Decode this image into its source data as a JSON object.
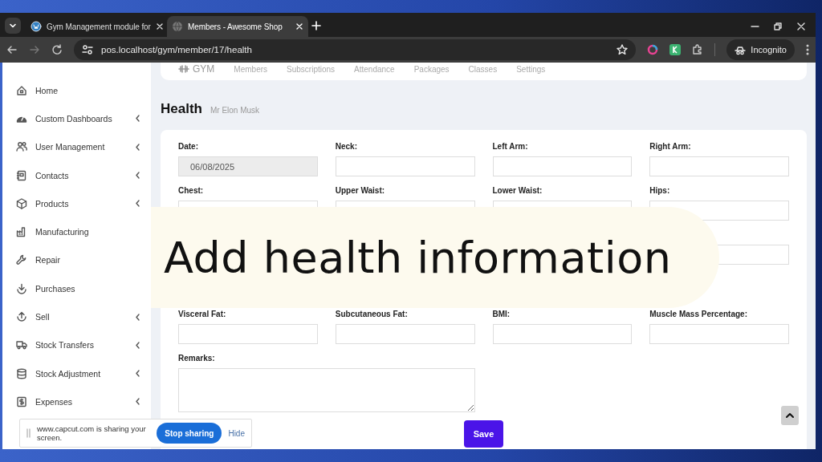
{
  "browser": {
    "tabs": [
      {
        "title": "Gym Management module for",
        "selected": false
      },
      {
        "title": "Members - Awesome Shop",
        "selected": true
      }
    ],
    "address": "pos.localhost/gym/member/17/health",
    "profile": "Incognito"
  },
  "sidebar": {
    "items": [
      {
        "label": "Home",
        "has_submenu": false
      },
      {
        "label": "Custom Dashboards",
        "has_submenu": true
      },
      {
        "label": "User Management",
        "has_submenu": true
      },
      {
        "label": "Contacts",
        "has_submenu": true
      },
      {
        "label": "Products",
        "has_submenu": true
      },
      {
        "label": "Manufacturing",
        "has_submenu": false
      },
      {
        "label": "Repair",
        "has_submenu": false
      },
      {
        "label": "Purchases",
        "has_submenu": false
      },
      {
        "label": "Sell",
        "has_submenu": true
      },
      {
        "label": "Stock Transfers",
        "has_submenu": true
      },
      {
        "label": "Stock Adjustment",
        "has_submenu": true
      },
      {
        "label": "Expenses",
        "has_submenu": true
      }
    ]
  },
  "top_nav": {
    "brand": "GYM",
    "items": [
      "Members",
      "Subscriptions",
      "Attendance",
      "Packages",
      "Classes",
      "Settings"
    ]
  },
  "page": {
    "title": "Health",
    "subtitle": "Mr Elon Musk"
  },
  "form": {
    "fields": [
      {
        "label": "Date:",
        "kind": "input",
        "value": "06/08/2025",
        "disabled": true
      },
      {
        "label": "Neck:",
        "kind": "input"
      },
      {
        "label": "Left Arm:",
        "kind": "input"
      },
      {
        "label": "Right Arm:",
        "kind": "input"
      },
      {
        "label": "Chest:",
        "kind": "input"
      },
      {
        "label": "Upper Waist:",
        "kind": "input"
      },
      {
        "label": "Lower Waist:",
        "kind": "input"
      },
      {
        "label": "Hips:",
        "kind": "input"
      },
      {
        "kind": "input"
      },
      {
        "label": "Visceral Fat:",
        "kind": "input"
      },
      {
        "label": "Subcutaneous Fat:",
        "kind": "input"
      },
      {
        "label": "BMI:",
        "kind": "input"
      },
      {
        "label": "Muscle Mass Percentage:",
        "kind": "input"
      },
      {
        "label": "Remarks:",
        "kind": "textarea"
      }
    ],
    "save": "Save"
  },
  "caption": "Add health information",
  "share_bar": {
    "message": "www.capcut.com is sharing your screen.",
    "stop": "Stop sharing",
    "hide": "Hide"
  }
}
